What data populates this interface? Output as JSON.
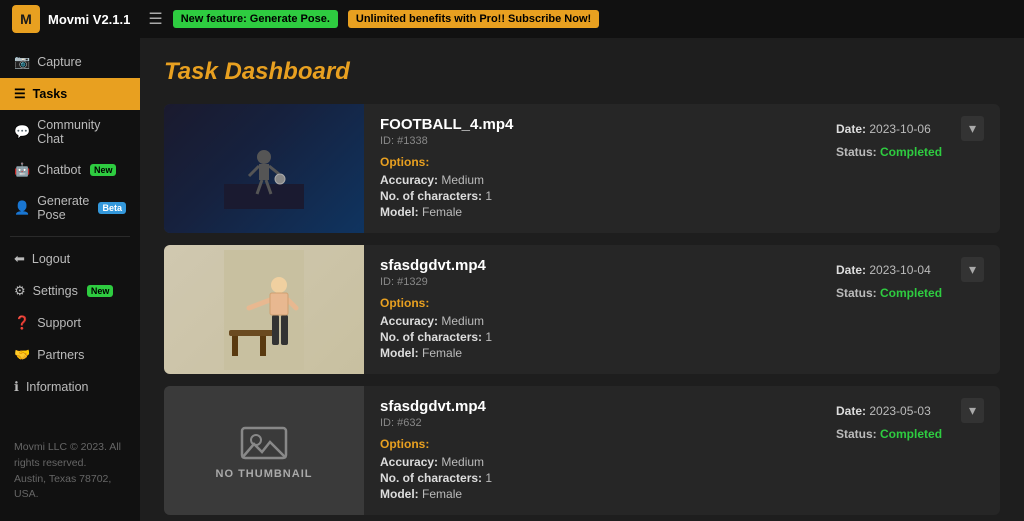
{
  "topbar": {
    "logo_text": "Movmi V2.1.1",
    "logo_icon": "M",
    "hamburger": "☰",
    "badge_green_label": "New feature: Generate Pose.",
    "badge_orange_label": "Unlimited benefits with Pro!! Subscribe Now!"
  },
  "sidebar": {
    "items": [
      {
        "id": "capture",
        "icon": "📷",
        "label": "Capture",
        "active": false
      },
      {
        "id": "tasks",
        "icon": "≡",
        "label": "Tasks",
        "active": true
      },
      {
        "id": "community",
        "icon": "💬",
        "label": "Community Chat",
        "active": false
      },
      {
        "id": "chatbot",
        "icon": "🤖",
        "label": "Chatbot",
        "active": false,
        "tag": "New",
        "tag_type": "new"
      },
      {
        "id": "generate",
        "icon": "👤",
        "label": "Generate Pose",
        "active": false,
        "tag": "Beta",
        "tag_type": "beta"
      },
      {
        "id": "logout",
        "icon": "⬅",
        "label": "Logout",
        "active": false
      },
      {
        "id": "settings",
        "icon": "⚙",
        "label": "Settings",
        "active": false,
        "tag": "New",
        "tag_type": "new"
      },
      {
        "id": "support",
        "icon": "❓",
        "label": "Support",
        "active": false
      },
      {
        "id": "partners",
        "icon": "🤝",
        "label": "Partners",
        "active": false
      },
      {
        "id": "information",
        "icon": "ℹ",
        "label": "Information",
        "active": false
      }
    ],
    "footer_line1": "Movmi LLC © 2023. All rights reserved.",
    "footer_line2": "Austin, Texas 78702, USA."
  },
  "main": {
    "title": "Task Dashboard",
    "tasks": [
      {
        "id": "task-1",
        "title": "FOOTBALL_4.mp4",
        "task_id": "ID: #1338",
        "options_label": "Options:",
        "accuracy": "Medium",
        "num_characters": "1",
        "model": "Female",
        "date": "2023-10-06",
        "status": "Completed",
        "has_thumbnail": true,
        "thumb_type": "football"
      },
      {
        "id": "task-2",
        "title": "sfasdgdvt.mp4",
        "task_id": "ID: #1329",
        "options_label": "Options:",
        "accuracy": "Medium",
        "num_characters": "1",
        "model": "Female",
        "date": "2023-10-04",
        "status": "Completed",
        "has_thumbnail": true,
        "thumb_type": "person"
      },
      {
        "id": "task-3",
        "title": "sfasdgdvt.mp4",
        "task_id": "ID: #632",
        "options_label": "Options:",
        "accuracy": "Medium",
        "num_characters": "1",
        "model": "Female",
        "date": "2023-05-03",
        "status": "Completed",
        "has_thumbnail": false,
        "thumb_type": "none",
        "no_thumb_label": "NO THUMBNAIL"
      }
    ]
  },
  "labels": {
    "accuracy": "Accuracy:",
    "num_characters": "No. of characters:",
    "model": "Model:",
    "date_prefix": "Date:",
    "status_prefix": "Status:"
  }
}
